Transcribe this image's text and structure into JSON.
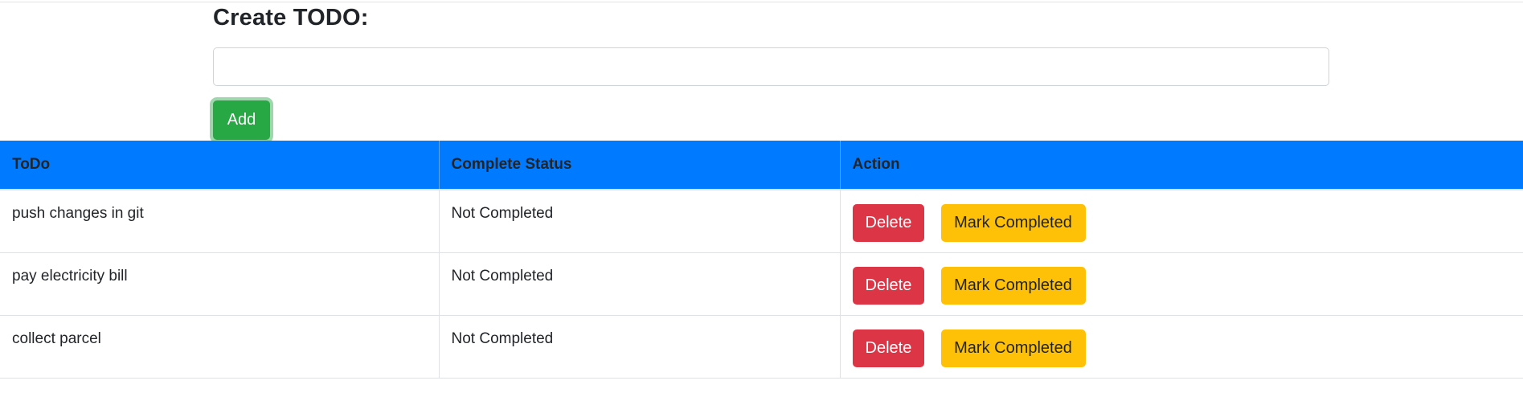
{
  "form": {
    "title": "Create TODO:",
    "input_value": "",
    "input_placeholder": "",
    "add_label": "Add"
  },
  "table": {
    "headers": [
      "ToDo",
      "Complete Status",
      "Action"
    ],
    "rows": [
      {
        "todo": "push changes in git",
        "status": "Not Completed",
        "delete_label": "Delete",
        "complete_label": "Mark Completed"
      },
      {
        "todo": "pay electricity bill",
        "status": "Not Completed",
        "delete_label": "Delete",
        "complete_label": "Mark Completed"
      },
      {
        "todo": "collect parcel",
        "status": "Not Completed",
        "delete_label": "Delete",
        "complete_label": "Mark Completed"
      }
    ]
  },
  "colors": {
    "header_bg": "#007bff",
    "add_button": "#28a745",
    "delete_button": "#dc3545",
    "complete_button": "#ffc107"
  }
}
